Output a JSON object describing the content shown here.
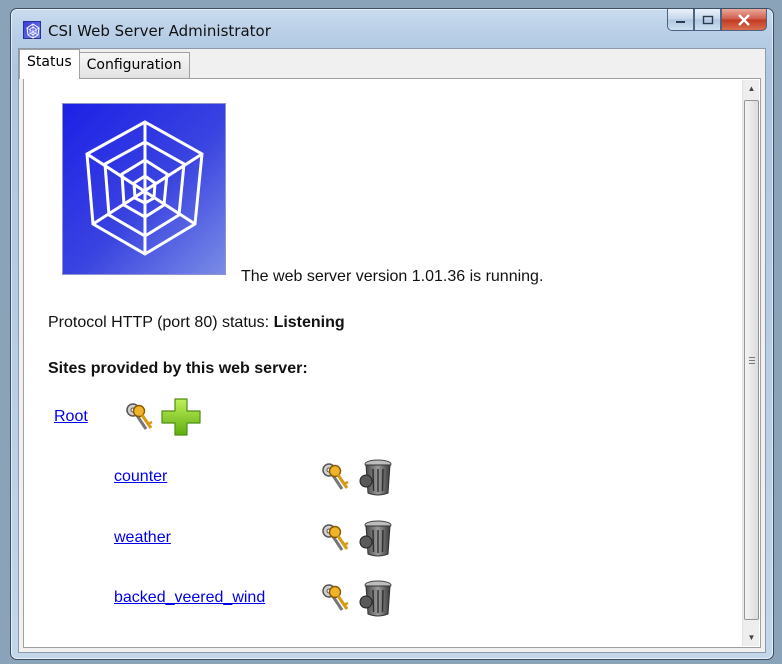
{
  "window": {
    "title": "CSI Web Server Administrator"
  },
  "tabs": [
    {
      "label": "Status"
    },
    {
      "label": "Configuration"
    }
  ],
  "status": {
    "running_text": "The web server version 1.01.36 is running.",
    "protocol_prefix": "Protocol HTTP (port 80) status: ",
    "protocol_status": "Listening",
    "sites_heading": "Sites provided by this web server:"
  },
  "sites": {
    "root": {
      "label": "Root"
    },
    "children": [
      {
        "label": "counter"
      },
      {
        "label": "weather"
      },
      {
        "label": "backed_veered_wind"
      }
    ]
  },
  "icons": {
    "app": "spider-web-icon",
    "site_settings": "keys-icon",
    "add_site": "plus-icon",
    "delete_site": "trash-icon"
  }
}
